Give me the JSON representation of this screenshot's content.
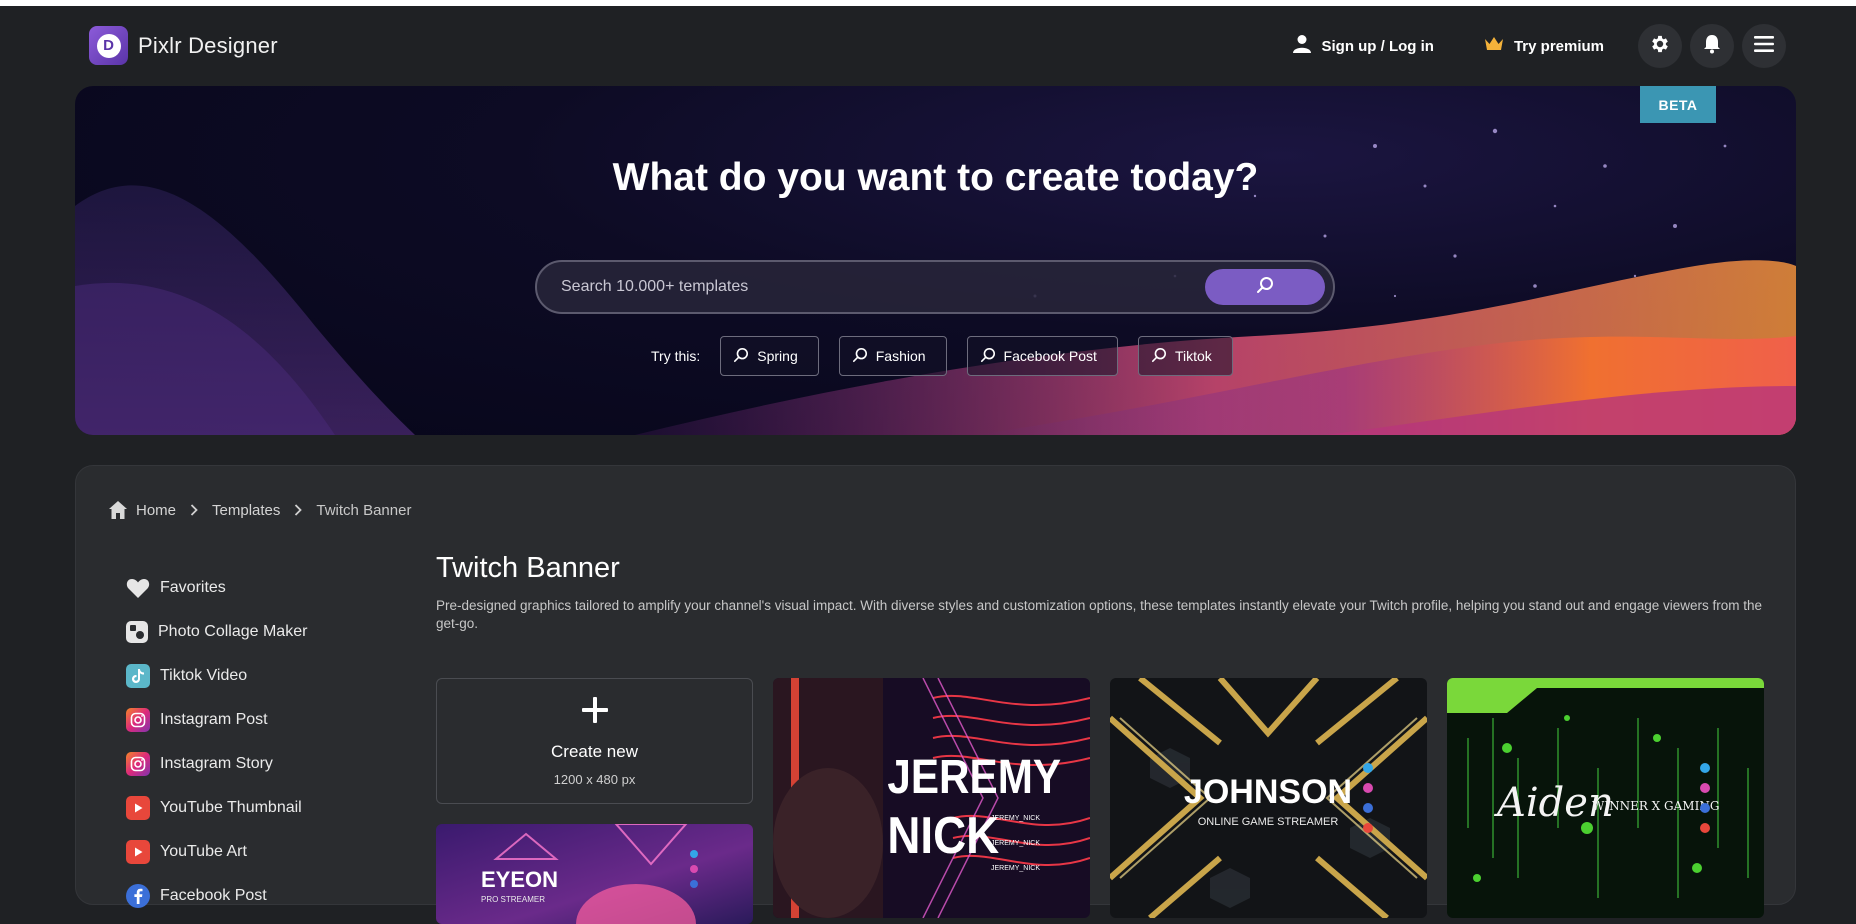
{
  "app": {
    "name": "Pixlr Designer",
    "logo_letter": "D"
  },
  "header": {
    "signin_label": "Sign up / Log in",
    "premium_label": "Try premium"
  },
  "hero": {
    "beta_badge": "BETA",
    "title": "What do you want to create today?",
    "search_placeholder": "Search 10.000+ templates",
    "try_label": "Try this:",
    "suggestions": [
      "Spring",
      "Fashion",
      "Facebook Post",
      "Tiktok"
    ]
  },
  "breadcrumb": {
    "items": [
      "Home",
      "Templates",
      "Twitch Banner"
    ]
  },
  "sidebar": {
    "items": [
      {
        "label": "Favorites",
        "icon": "heart-icon"
      },
      {
        "label": "Photo Collage Maker",
        "icon": "collage-icon"
      },
      {
        "label": "Tiktok Video",
        "icon": "tiktok-icon"
      },
      {
        "label": "Instagram Post",
        "icon": "instagram-icon"
      },
      {
        "label": "Instagram Story",
        "icon": "instagram-icon"
      },
      {
        "label": "YouTube Thumbnail",
        "icon": "youtube-icon"
      },
      {
        "label": "YouTube Art",
        "icon": "youtube-icon"
      },
      {
        "label": "Facebook Post",
        "icon": "facebook-icon"
      }
    ]
  },
  "main": {
    "title": "Twitch Banner",
    "description": "Pre-designed graphics tailored to amplify your channel's visual impact. With diverse styles and customization options, these templates instantly elevate your Twitch profile, helping you stand out and engage viewers from the get-go.",
    "create_label": "Create new",
    "create_size": "1200 x 480 px"
  },
  "templates": [
    {
      "line1": "JEREMY",
      "line2": "NICK",
      "handle": "JEREMY_NICK"
    },
    {
      "line1": "JOHNSON",
      "line2": "ONLINE GAME STREAMER"
    },
    {
      "line1": "Aiden",
      "line2": "WINNER X GAMING"
    },
    {
      "line1": "EYEON",
      "line2": "PRO STREAMER"
    }
  ],
  "colors": {
    "accent": "#7b5cc3",
    "beta": "#3b96b3",
    "background": "#1f2124",
    "panel": "#2a2c2f"
  }
}
